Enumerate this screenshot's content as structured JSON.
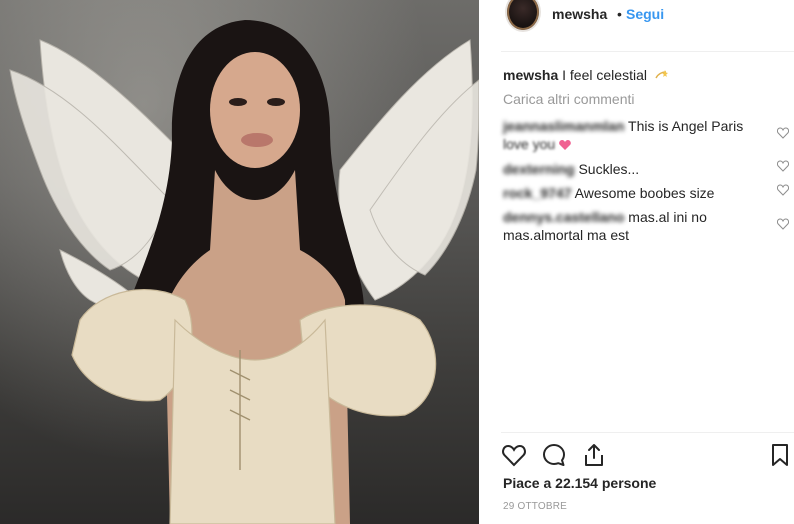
{
  "post": {
    "username": "mewsha",
    "follow_label": "Segui",
    "separator": "•"
  },
  "caption": {
    "username": "mewsha",
    "text": "I feel celestial",
    "emoji_icon": "dizzy-star-icon"
  },
  "comments": {
    "load_more_label": "Carica altri commenti",
    "items": [
      {
        "username": "jeannaslimanmlan",
        "text": "This is Angel Paris",
        "text_line2": "love you"
      },
      {
        "username": "dexterning",
        "text": "Suckles..."
      },
      {
        "username": "rock_9747",
        "text": "Awesome boobes size"
      },
      {
        "username": "dennys.castellano",
        "text": "mas.al ini no",
        "text_line2": "mas.almortal ma est"
      }
    ]
  },
  "actions": {
    "like_icon": "heart-outline-icon",
    "comment_icon": "speech-bubble-icon",
    "share_icon": "share-upload-icon",
    "save_icon": "bookmark-icon"
  },
  "likes_text": "Piace a 22.154 persone",
  "date_text": "29 OTTOBRE",
  "colors": {
    "link_blue": "#3897f0",
    "text": "#262626",
    "muted": "#999999",
    "divider": "#efefef"
  }
}
